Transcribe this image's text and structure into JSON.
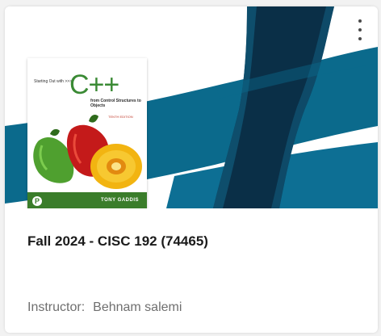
{
  "card": {
    "menu_icon": "more-vert-icon",
    "book": {
      "small_title": "Starting Out with >>>",
      "main_title": "C++",
      "subtitle": "from Control Structures to Objects",
      "edition": "TENTH EDITION",
      "author": "TONY GADDIS",
      "publisher_logo": "P",
      "cover_color": "#3a7d2a"
    },
    "course_title": "Fall 2024 - CISC 192 (74465)",
    "instructor_label": "Instructor:",
    "instructor_name": "Behnam salemi"
  },
  "colors": {
    "banner_blue": "#0b6a8c",
    "banner_dark": "#0a2f47",
    "title_text": "#1b1b1b",
    "muted_text": "#6f6f6f"
  }
}
